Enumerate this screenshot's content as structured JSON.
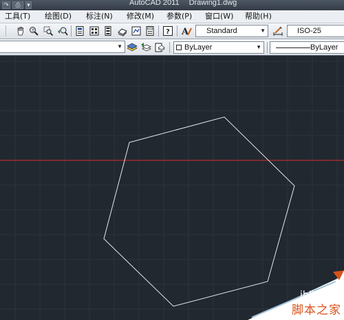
{
  "window": {
    "app_title": "AutoCAD 2011",
    "document_title": "Drawing1.dwg"
  },
  "menubar": {
    "items": [
      "工具(T)",
      "绘图(D)",
      "标注(N)",
      "修改(M)",
      "参数(P)",
      "窗口(W)",
      "帮助(H)"
    ]
  },
  "toolbar": {
    "text_style": "Standard",
    "dim_style": "ISO-25",
    "color": "ByLayer",
    "linetype": "ByLayer"
  },
  "watermark": {
    "url": "jb51.net",
    "name": "脚本之家"
  },
  "colors": {
    "canvas_bg": "#212830",
    "grid_line": "#2c3440",
    "crosshair": "#9b2a2a",
    "hexagon_stroke": "#e8e8e8",
    "watermark_accent": "#d8531c"
  }
}
